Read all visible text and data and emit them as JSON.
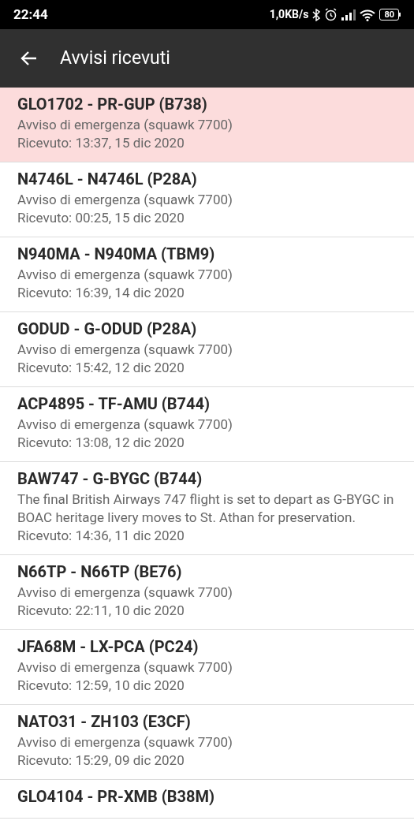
{
  "status_bar": {
    "time": "22:44",
    "network_speed": "1,0KB/s",
    "battery": "80"
  },
  "app_bar": {
    "title": "Avvisi ricevuti"
  },
  "alerts": [
    {
      "title": "GLO1702 - PR-GUP (B738)",
      "description": "Avviso di emergenza (squawk 7700)",
      "received": "Ricevuto: 13:37, 15 dic 2020",
      "selected": true
    },
    {
      "title": "N4746L - N4746L (P28A)",
      "description": "Avviso di emergenza (squawk 7700)",
      "received": "Ricevuto: 00:25, 15 dic 2020",
      "selected": false
    },
    {
      "title": "N940MA - N940MA (TBM9)",
      "description": "Avviso di emergenza (squawk 7700)",
      "received": "Ricevuto: 16:39, 14 dic 2020",
      "selected": false
    },
    {
      "title": "GODUD - G-ODUD (P28A)",
      "description": "Avviso di emergenza (squawk 7700)",
      "received": "Ricevuto: 15:42, 12 dic 2020",
      "selected": false
    },
    {
      "title": "ACP4895 - TF-AMU (B744)",
      "description": "Avviso di emergenza (squawk 7700)",
      "received": "Ricevuto: 13:08, 12 dic 2020",
      "selected": false
    },
    {
      "title": "BAW747 - G-BYGC (B744)",
      "description": "The final British Airways 747 flight is set to depart as G-BYGC in BOAC heritage livery moves to St. Athan for preservation.",
      "received": "Ricevuto: 14:36, 11 dic 2020",
      "selected": false
    },
    {
      "title": "N66TP - N66TP (BE76)",
      "description": "Avviso di emergenza (squawk 7700)",
      "received": "Ricevuto: 22:11, 10 dic 2020",
      "selected": false
    },
    {
      "title": "JFA68M - LX-PCA (PC24)",
      "description": "Avviso di emergenza (squawk 7700)",
      "received": "Ricevuto: 12:59, 10 dic 2020",
      "selected": false
    },
    {
      "title": "NATO31 - ZH103 (E3CF)",
      "description": "Avviso di emergenza (squawk 7700)",
      "received": "Ricevuto: 15:29, 09 dic 2020",
      "selected": false
    },
    {
      "title": "GLO4104 - PR-XMB (B38M)",
      "selected": false
    }
  ]
}
